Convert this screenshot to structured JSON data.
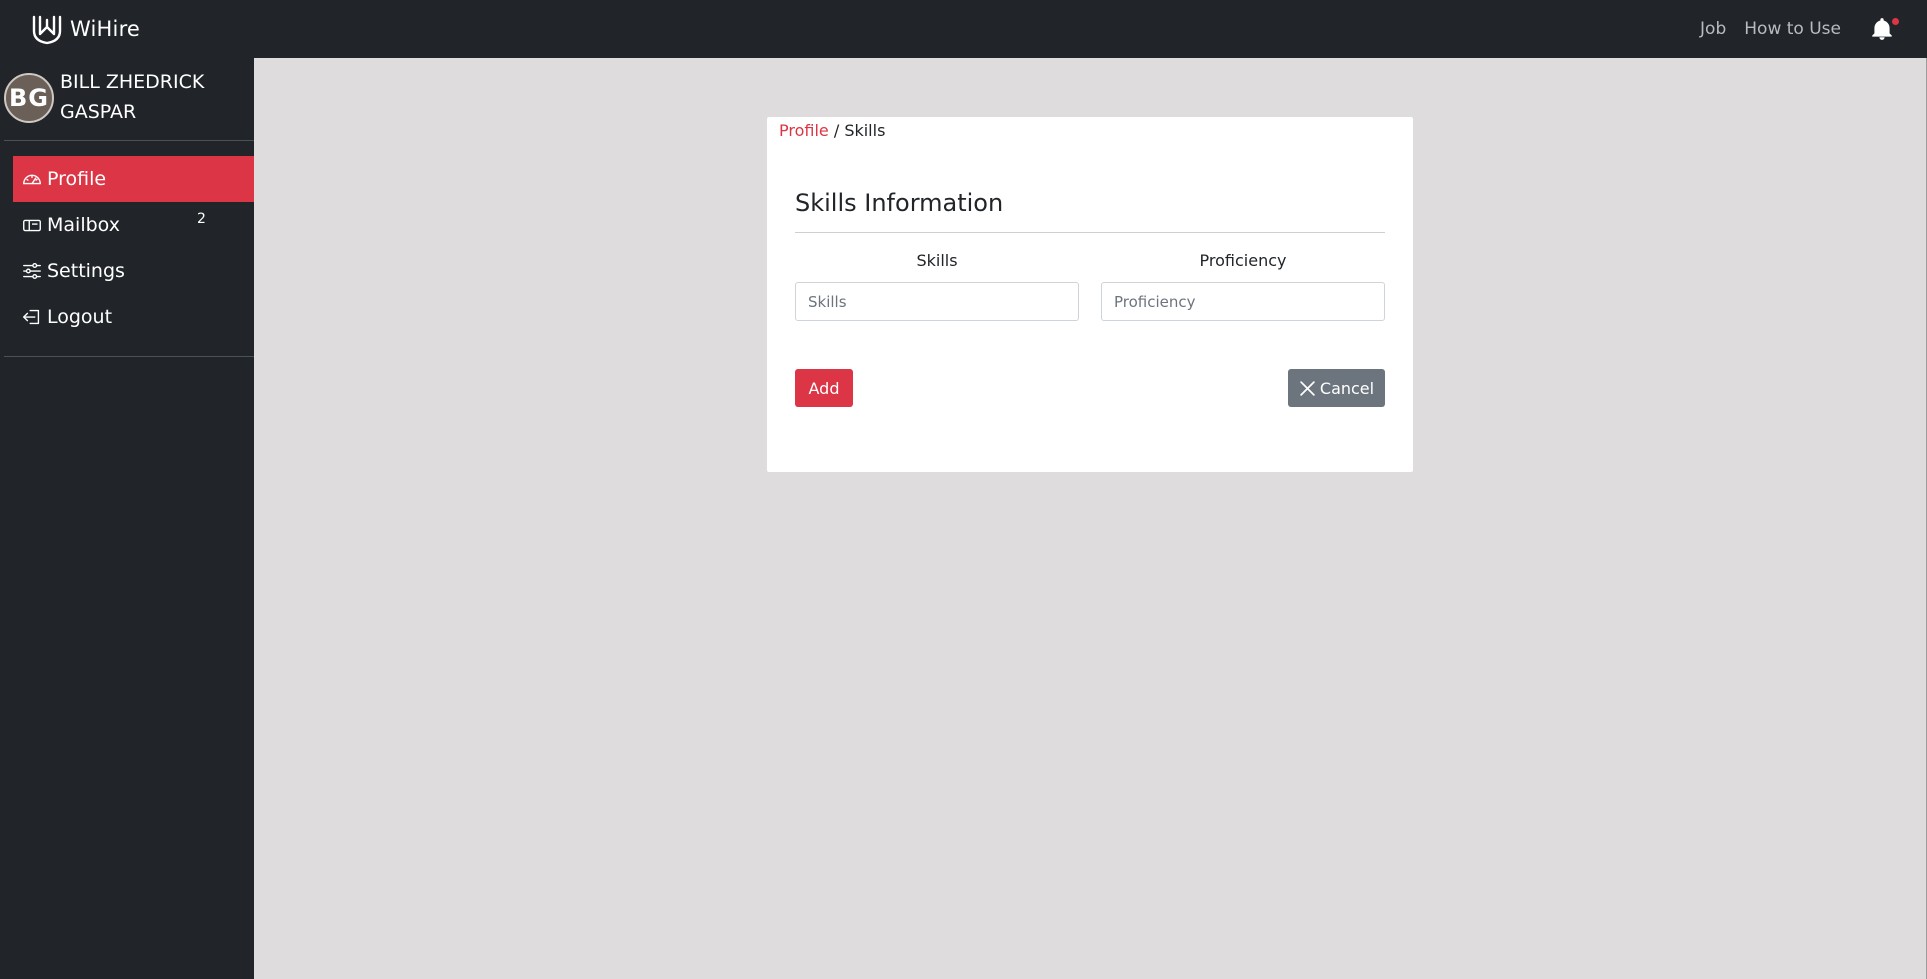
{
  "header": {
    "brand_name": "WiHire",
    "brand_icon": "wihire-logo-icon",
    "nav_links": [
      "Job",
      "How to Use"
    ],
    "notification_icon": "bell-icon"
  },
  "sidebar": {
    "user": {
      "initials": "BG",
      "name": "BILL ZHEDRICK GASPAR"
    },
    "items": [
      {
        "label": "Profile",
        "icon": "dashboard-icon",
        "active": true
      },
      {
        "label": "Mailbox",
        "icon": "mailbox-icon",
        "badge": "2"
      },
      {
        "label": "Settings",
        "icon": "sliders-icon"
      },
      {
        "label": "Logout",
        "icon": "logout-icon"
      }
    ]
  },
  "breadcrumb": {
    "link": "Profile",
    "separator": " / ",
    "current": "Skills"
  },
  "form": {
    "title": "Skills Information",
    "skills_label": "Skills",
    "skills_placeholder": "Skills",
    "proficiency_label": "Proficiency",
    "proficiency_placeholder": "Proficiency",
    "add_label": "Add",
    "cancel_label": "Cancel"
  },
  "colors": {
    "accent": "#dc3545",
    "dark": "#212529",
    "content_bg": "#dedcdd",
    "secondary": "#6c757d"
  }
}
